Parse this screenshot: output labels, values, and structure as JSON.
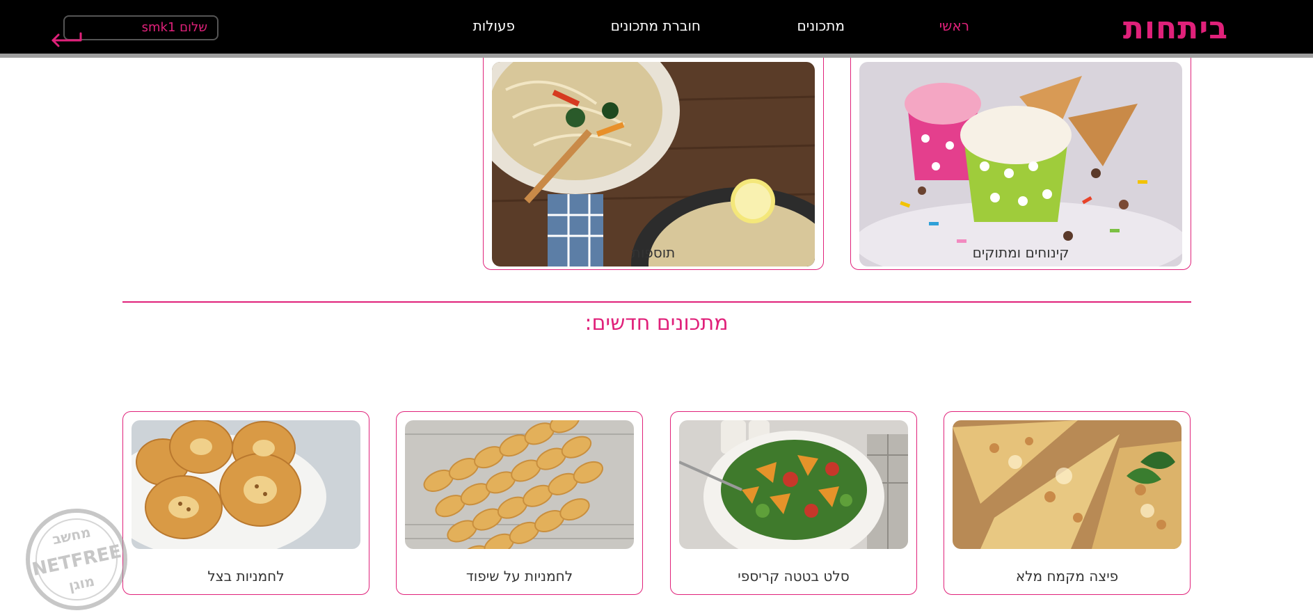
{
  "header": {
    "logo": "ביתחות",
    "nav": [
      {
        "label": "ראשי",
        "active": true
      },
      {
        "label": "מתכונים",
        "active": false
      },
      {
        "label": "חוברת מתכונים",
        "active": false
      },
      {
        "label": "פעולות",
        "active": false
      }
    ],
    "greeting": "שלום smk1",
    "logout_icon": "logout-arrow-icon"
  },
  "categories": [
    {
      "label": "קינוחים ומתוקים",
      "image": "ice-cream-sprinkles-image"
    },
    {
      "label": "תוספות",
      "image": "noodles-plate-image"
    }
  ],
  "new_recipes": {
    "title": "מתכונים חדשים:",
    "items": [
      {
        "label": "פיצה מקמח מלא",
        "image": "whole-wheat-pizza-image"
      },
      {
        "label": "סלט בטטה קריספי",
        "image": "crispy-sweet-potato-salad-image"
      },
      {
        "label": "לחמניות על שיפוד",
        "image": "skewer-rolls-image"
      },
      {
        "label": "לחמניות בצל",
        "image": "onion-rolls-image"
      }
    ]
  },
  "watermark": {
    "top": "מחשב",
    "middle": "NETFREE",
    "bottom": "מוגן"
  },
  "colors": {
    "accent": "#e0217a",
    "header_bg": "#000000",
    "header_border": "#9e9e9e"
  }
}
